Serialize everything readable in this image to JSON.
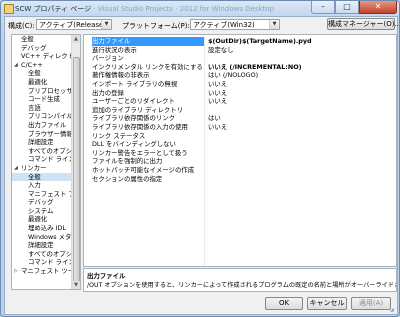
{
  "window": {
    "title_main": "SCW プロパティ ページ",
    "title_blurred": "· Visual Studio Projects · 2012 for Windows Desktop",
    "min_glyph": "–",
    "max_glyph": "□",
    "close_glyph": "✕"
  },
  "config_bar": {
    "config_label": "構成(C):",
    "config_value": "アクティブ(Release)",
    "platform_label": "プラットフォーム(P):",
    "platform_value": "アクティブ(Win32)",
    "manager_button": "構成マネージャー(O)..."
  },
  "tree": {
    "items": [
      {
        "label": "全般",
        "indent": 1,
        "toggle": "",
        "selected": false
      },
      {
        "label": "デバッグ",
        "indent": 1,
        "toggle": "",
        "selected": false
      },
      {
        "label": "VC++ ディレクトリ",
        "indent": 1,
        "toggle": "",
        "selected": false
      },
      {
        "label": "C/C++",
        "indent": 0,
        "toggle": "◢",
        "selected": false
      },
      {
        "label": "全般",
        "indent": 2,
        "toggle": "",
        "selected": false
      },
      {
        "label": "最適化",
        "indent": 2,
        "toggle": "",
        "selected": false
      },
      {
        "label": "プリプロセッサ",
        "indent": 2,
        "toggle": "",
        "selected": false
      },
      {
        "label": "コード生成",
        "indent": 2,
        "toggle": "",
        "selected": false
      },
      {
        "label": "言語",
        "indent": 2,
        "toggle": "",
        "selected": false
      },
      {
        "label": "プリコンパイル済みヘッダー",
        "indent": 2,
        "toggle": "",
        "selected": false
      },
      {
        "label": "出力ファイル",
        "indent": 2,
        "toggle": "",
        "selected": false
      },
      {
        "label": "ブラウザー情報",
        "indent": 2,
        "toggle": "",
        "selected": false
      },
      {
        "label": "詳細設定",
        "indent": 2,
        "toggle": "",
        "selected": false
      },
      {
        "label": "すべてのオプション",
        "indent": 2,
        "toggle": "",
        "selected": false
      },
      {
        "label": "コマンド ライン",
        "indent": 2,
        "toggle": "",
        "selected": false
      },
      {
        "label": "リンカー",
        "indent": 0,
        "toggle": "◢",
        "selected": false
      },
      {
        "label": "全般",
        "indent": 2,
        "toggle": "",
        "selected": true
      },
      {
        "label": "入力",
        "indent": 2,
        "toggle": "",
        "selected": false
      },
      {
        "label": "マニフェスト ファイル",
        "indent": 2,
        "toggle": "",
        "selected": false
      },
      {
        "label": "デバッグ",
        "indent": 2,
        "toggle": "",
        "selected": false
      },
      {
        "label": "システム",
        "indent": 2,
        "toggle": "",
        "selected": false
      },
      {
        "label": "最適化",
        "indent": 2,
        "toggle": "",
        "selected": false
      },
      {
        "label": "埋め込み IDL",
        "indent": 2,
        "toggle": "",
        "selected": false
      },
      {
        "label": "Windows メタデータ",
        "indent": 2,
        "toggle": "",
        "selected": false
      },
      {
        "label": "詳細設定",
        "indent": 2,
        "toggle": "",
        "selected": false
      },
      {
        "label": "すべてのオプション",
        "indent": 2,
        "toggle": "",
        "selected": false
      },
      {
        "label": "コマンド ライン",
        "indent": 2,
        "toggle": "",
        "selected": false
      },
      {
        "label": "マニフェスト ツール",
        "indent": 0,
        "toggle": "▷",
        "selected": false
      }
    ],
    "scroll_up": "▲",
    "scroll_down": "▼"
  },
  "properties": [
    {
      "name": "出力ファイル",
      "value": "$(OutDir)$(TargetName).pyd",
      "bold": true,
      "selected": true
    },
    {
      "name": "進行状況の表示",
      "value": "設定なし",
      "bold": false,
      "selected": false
    },
    {
      "name": "バージョン",
      "value": "",
      "bold": false,
      "selected": false
    },
    {
      "name": "インクリメンタル リンクを有効にする",
      "value": "いいえ (/INCREMENTAL:NO)",
      "bold": true,
      "selected": false
    },
    {
      "name": "著作権情報の非表示",
      "value": "はい (/NOLOGO)",
      "bold": false,
      "selected": false
    },
    {
      "name": "インポート ライブラリの無視",
      "value": "いいえ",
      "bold": false,
      "selected": false
    },
    {
      "name": "出力の登録",
      "value": "いいえ",
      "bold": false,
      "selected": false
    },
    {
      "name": "ユーザーごとのリダイレクト",
      "value": "いいえ",
      "bold": false,
      "selected": false
    },
    {
      "name": "追加のライブラリ ディレクトリ",
      "value": "",
      "bold": false,
      "selected": false
    },
    {
      "name": "ライブラリ依存関係のリンク",
      "value": "はい",
      "bold": false,
      "selected": false
    },
    {
      "name": "ライブラリ依存関係の入力の使用",
      "value": "いいえ",
      "bold": false,
      "selected": false
    },
    {
      "name": "リンク ステータス",
      "value": "",
      "bold": false,
      "selected": false
    },
    {
      "name": "DLL をバインディングしない",
      "value": "",
      "bold": false,
      "selected": false
    },
    {
      "name": "リンカー警告をエラーとして扱う",
      "value": "",
      "bold": false,
      "selected": false
    },
    {
      "name": "ファイルを強制的に出力",
      "value": "",
      "bold": false,
      "selected": false
    },
    {
      "name": "ホットパッチ可能なイメージの作成",
      "value": "",
      "bold": false,
      "selected": false
    },
    {
      "name": "セクションの属性の指定",
      "value": "",
      "bold": false,
      "selected": false
    }
  ],
  "description": {
    "title": "出力ファイル",
    "text": "/OUT オプションを使用すると、リンカーによって作成されるプログラムの既定の名前と場所がオーバーライドされます。"
  },
  "buttons": {
    "ok": "OK",
    "cancel": "キャンセル",
    "apply": "適用(A)"
  },
  "colors": {
    "selection": "#3399ff",
    "tree_selection": "#cfe3f7"
  }
}
